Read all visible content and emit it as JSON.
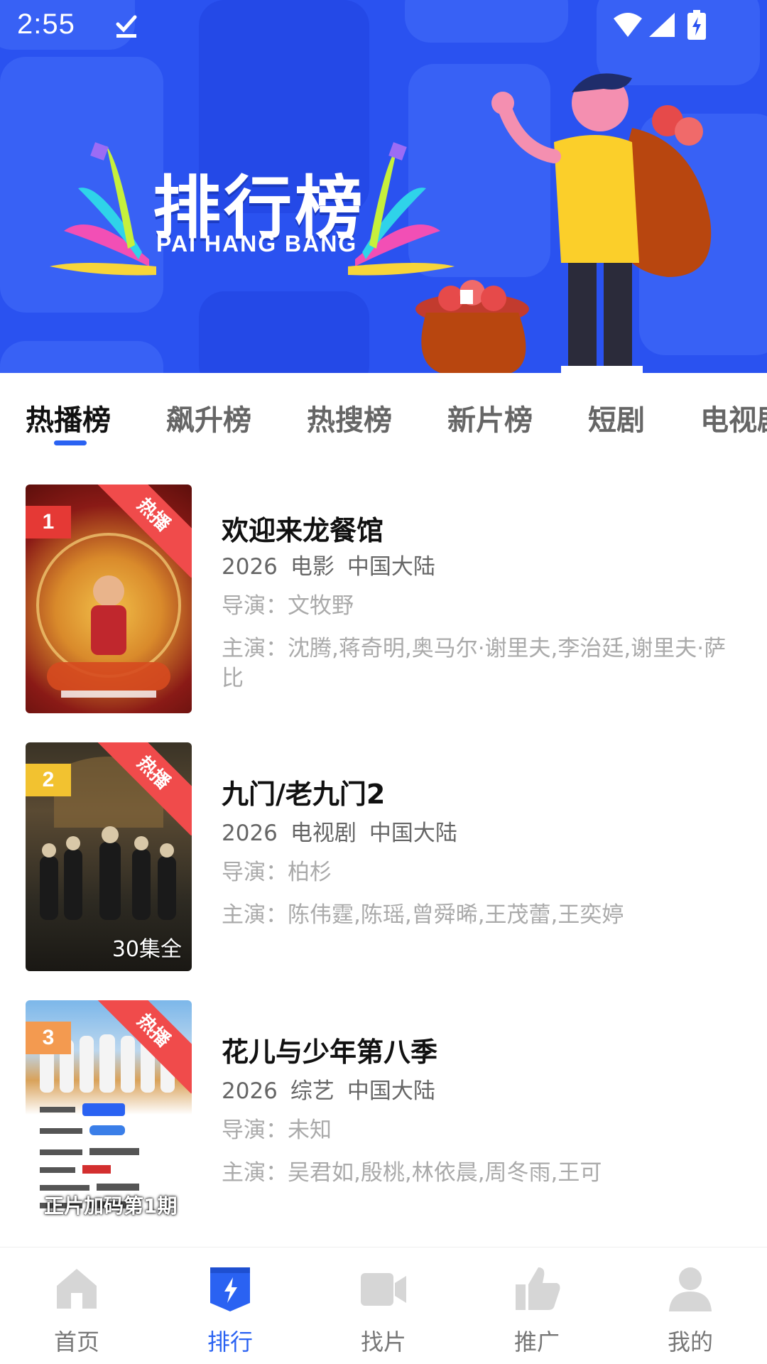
{
  "status_bar": {
    "time": "2:55"
  },
  "banner": {
    "title": "排行榜",
    "subtitle": "PAI HANG BANG"
  },
  "tabs": [
    {
      "label": "热播榜",
      "active": true
    },
    {
      "label": "飙升榜",
      "active": false
    },
    {
      "label": "热搜榜",
      "active": false
    },
    {
      "label": "新片榜",
      "active": false
    },
    {
      "label": "短剧",
      "active": false
    },
    {
      "label": "电视剧",
      "active": false
    }
  ],
  "items": [
    {
      "rank": "1",
      "badge": "热播",
      "title": "欢迎来龙餐馆",
      "year": "2026",
      "category": "电影",
      "region": "中国大陆",
      "director": "导演：文牧野",
      "cast": "主演：沈腾,蒋奇明,奥马尔·谢里夫,李治廷,谢里夫·萨比",
      "poster_overlay": ""
    },
    {
      "rank": "2",
      "badge": "热播",
      "title": "九门/老九门2",
      "year": "2026",
      "category": "电视剧",
      "region": "中国大陆",
      "director": "导演：柏杉",
      "cast": "主演：陈伟霆,陈瑶,曾舜晞,王茂蕾,王奕婷",
      "poster_overlay": "30集全"
    },
    {
      "rank": "3",
      "badge": "热播",
      "title": "花儿与少年第八季",
      "year": "2026",
      "category": "综艺",
      "region": "中国大陆",
      "director": "导演：未知",
      "cast": "主演：吴君如,殷桃,林依晨,周冬雨,王可",
      "poster_overlay": "正片加码第1期"
    }
  ],
  "bottom_nav": [
    {
      "label": "首页",
      "icon": "home-icon",
      "active": false
    },
    {
      "label": "排行",
      "icon": "ranking-icon",
      "active": true
    },
    {
      "label": "找片",
      "icon": "video-camera-icon",
      "active": false
    },
    {
      "label": "推广",
      "icon": "thumbs-up-icon",
      "active": false
    },
    {
      "label": "我的",
      "icon": "profile-icon",
      "active": false
    }
  ],
  "colors": {
    "banner_bg": "#2a52f0",
    "accent": "#2a62f2",
    "rank1": "#e53935",
    "rank2": "#f2c230",
    "rank3": "#f39a50",
    "badge": "#f04b4b"
  }
}
